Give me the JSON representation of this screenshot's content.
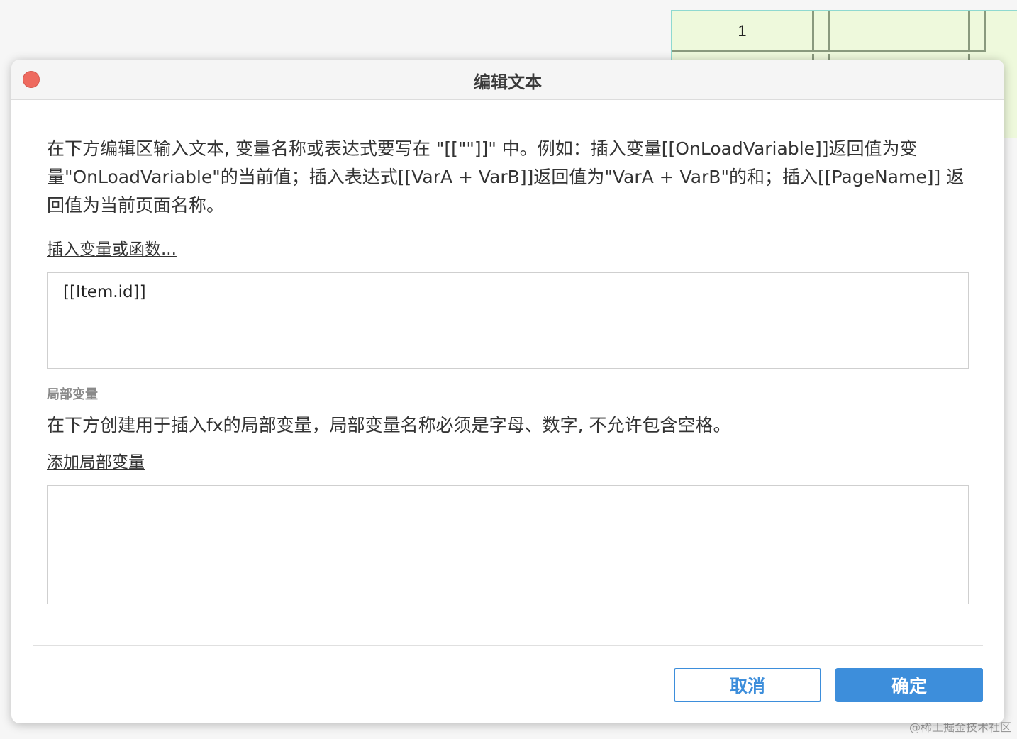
{
  "background": {
    "table_cell_1": "1",
    "watermark": "@稀土掘金技术社区"
  },
  "dialog": {
    "title": "编辑文本",
    "description": "在下方编辑区输入文本, 变量名称或表达式要写在 \"[[\"\"]]\" 中。例如：插入变量[[OnLoadVariable]]返回值为变量\"OnLoadVariable\"的当前值；插入表达式[[VarA + VarB]]返回值为\"VarA + VarB\"的和；插入[[PageName]] 返回值为当前页面名称。",
    "insert_link": "插入变量或函数...",
    "text_value": "[[Item.id]]",
    "local_vars_label": "局部变量",
    "local_vars_description": "在下方创建用于插入fx的局部变量，局部变量名称必须是字母、数字, 不允许包含空格。",
    "add_local_var_link": "添加局部变量",
    "cancel_label": "取消",
    "ok_label": "确定"
  },
  "colors": {
    "accent": "#3d8edb",
    "close": "#ee6a5f"
  }
}
